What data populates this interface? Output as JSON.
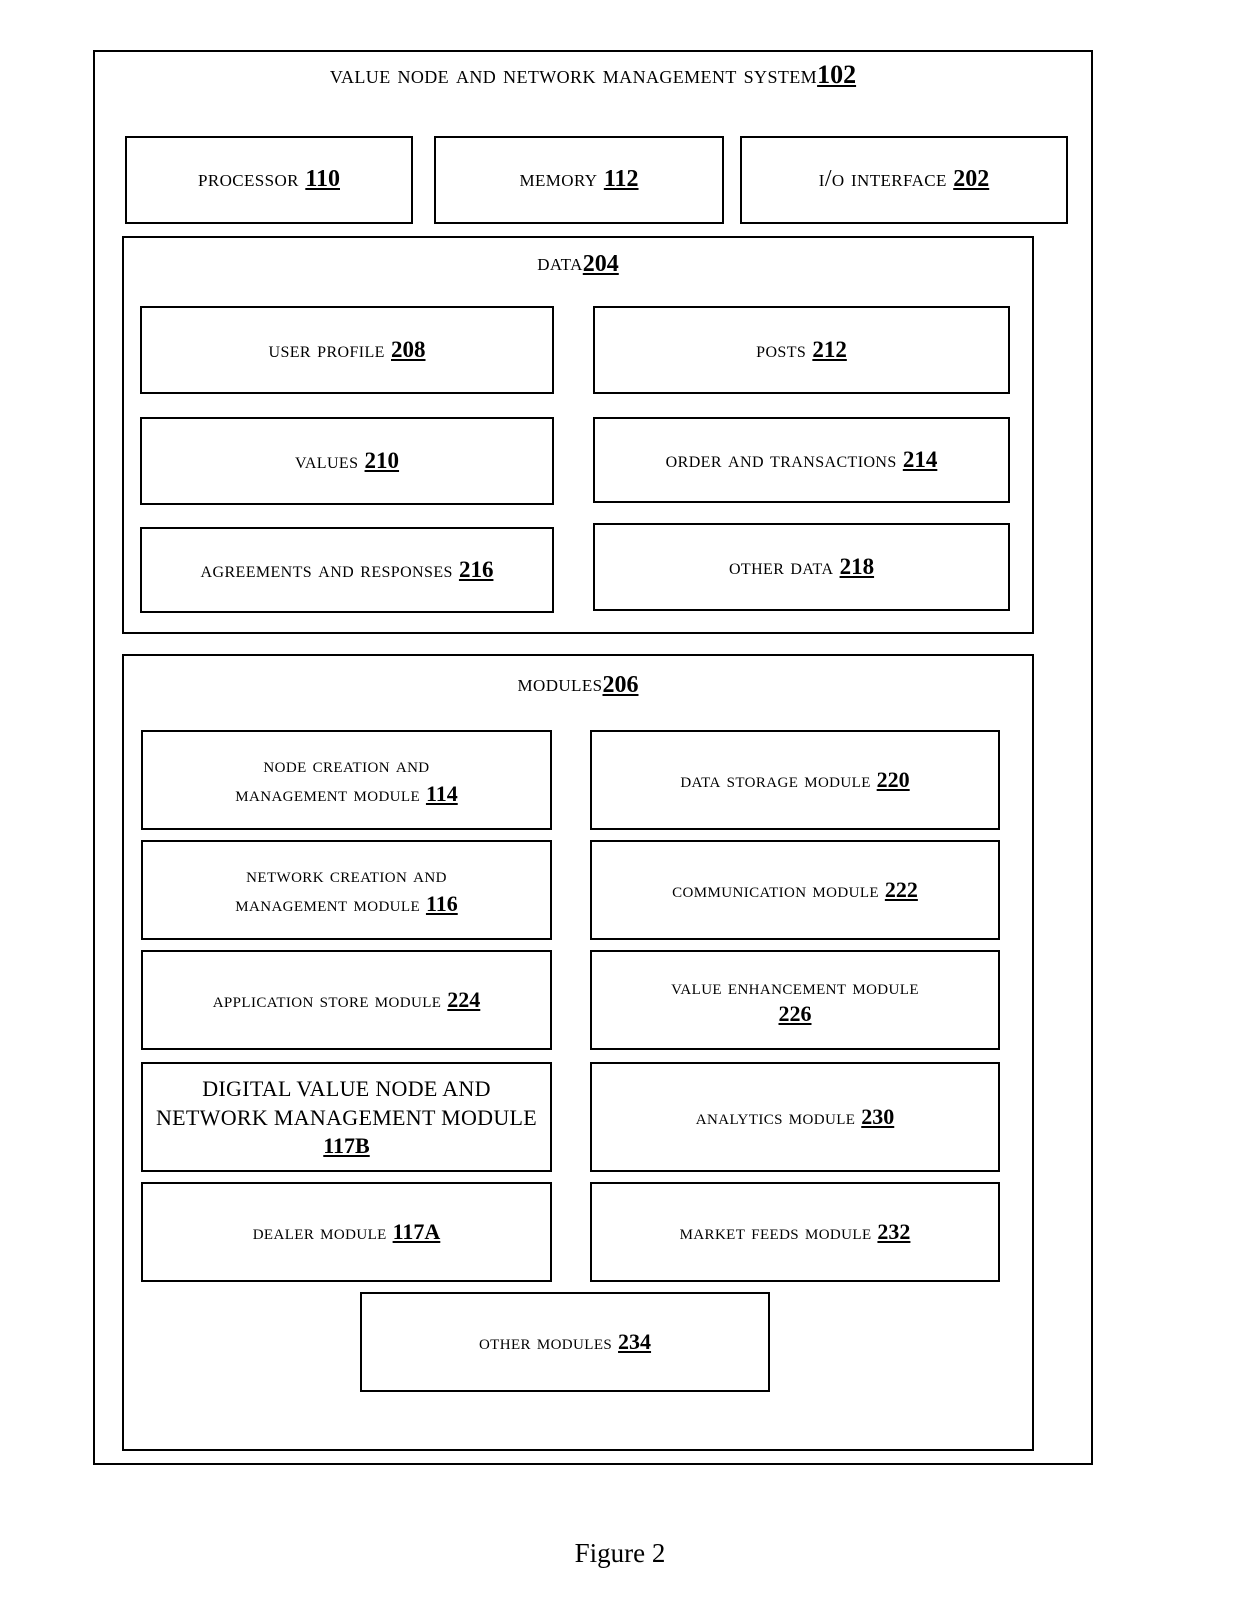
{
  "figure": {
    "caption": "Figure 2"
  },
  "system": {
    "title": "Value Node and Network Management System ",
    "title_ref": "102"
  },
  "hardware": [
    {
      "label": "Processor ",
      "ref": "110",
      "name": "processor"
    },
    {
      "label": "Memory ",
      "ref": "112",
      "name": "memory"
    },
    {
      "label": "I/O Interface ",
      "ref": "202",
      "name": "io-interface"
    }
  ],
  "data_section": {
    "title": "Data ",
    "title_ref": "204",
    "left_column": [
      {
        "label": "User Profile ",
        "ref": "208"
      },
      {
        "label": "Values ",
        "ref": "210"
      },
      {
        "label": "Agreements and Responses ",
        "ref": "216"
      }
    ],
    "right_column": [
      {
        "label": "Posts  ",
        "ref": "212"
      },
      {
        "label": "Order and Transactions ",
        "ref": "214"
      },
      {
        "label": "Other Data ",
        "ref": "218"
      }
    ]
  },
  "modules_section": {
    "title": "Modules ",
    "title_ref": "206",
    "left_column": [
      {
        "label": "Node Creation and\nManagement Module ",
        "ref": "114",
        "style": "smallcaps"
      },
      {
        "label": "Network Creation and\nManagement Module  ",
        "ref": "116",
        "style": "smallcaps"
      },
      {
        "label": "Application Store Module  ",
        "ref": "224",
        "style": "smallcaps"
      },
      {
        "label": "Digital Value Node and\nNetwork Management Module\n",
        "ref": "117B",
        "style": "allcaps"
      },
      {
        "label": "Dealer Module ",
        "ref": "117A",
        "style": "smallcaps"
      }
    ],
    "right_column": [
      {
        "label": "Data Storage Module  ",
        "ref": "220",
        "style": "smallcaps"
      },
      {
        "label": "Communication Module ",
        "ref": "222",
        "style": "smallcaps"
      },
      {
        "label": "Value Enhancement Module\n",
        "ref": "226",
        "style": "smallcaps"
      },
      {
        "label": "Analytics Module ",
        "ref": "230",
        "style": "smallcaps"
      },
      {
        "label": "Market Feeds Module ",
        "ref": "232",
        "style": "smallcaps"
      }
    ],
    "footer_box": {
      "label": "Other Modules ",
      "ref": "234",
      "style": "smallcaps"
    }
  }
}
